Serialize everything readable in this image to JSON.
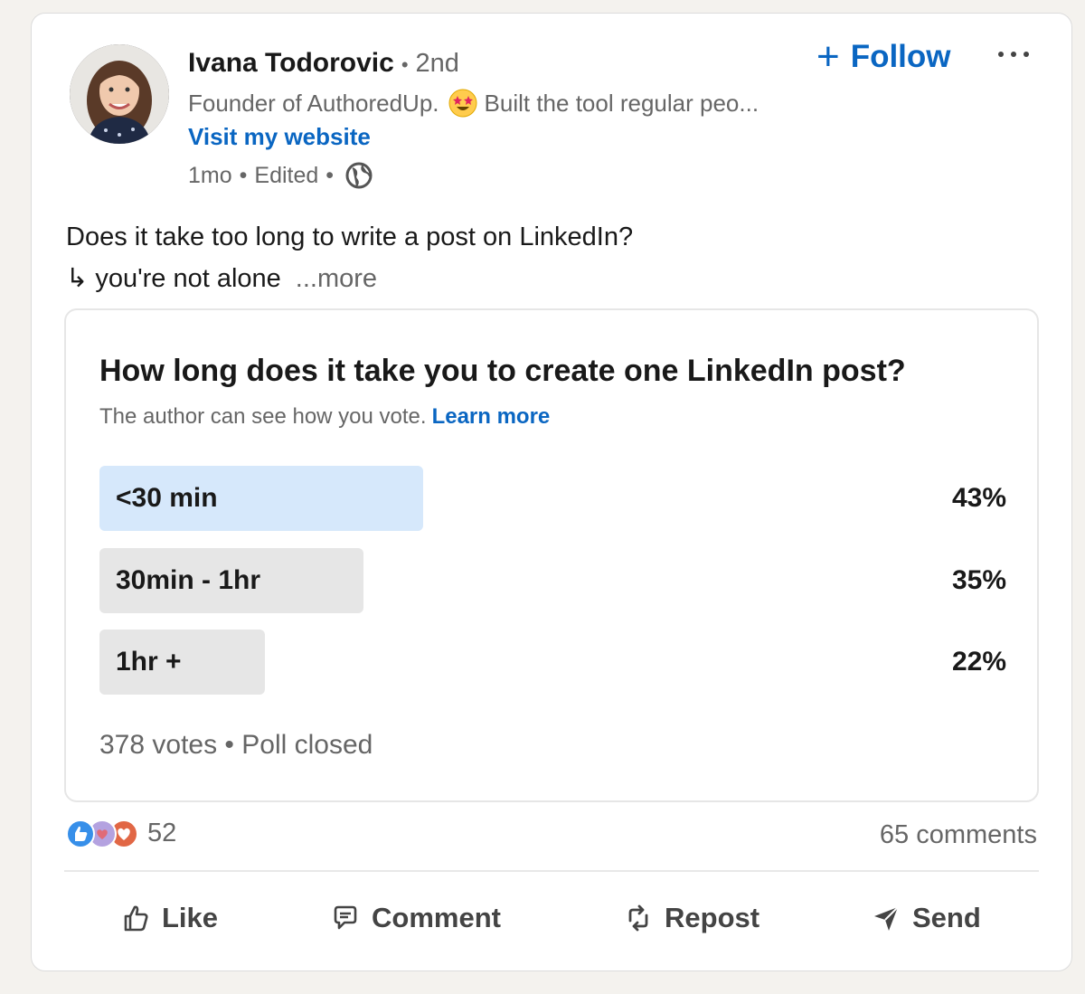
{
  "author": {
    "name": "Ivana Todorovic",
    "degree": "2nd",
    "degree_sep": "•",
    "headline_start": "Founder of AuthoredUp.",
    "headline_end": "Built the tool regular peo...",
    "website_label": "Visit my website",
    "time": "1mo",
    "edited": "Edited",
    "meta_sep": "•"
  },
  "follow_label": "Follow",
  "follow_plus": "+",
  "post": {
    "line1": "Does it take too long to write a post on LinkedIn?",
    "line2_arrow": "↳",
    "line2": "you're not alone",
    "more": "...more"
  },
  "poll": {
    "question": "How long does it take you to create one LinkedIn post?",
    "note": "The author can see how you vote.",
    "learn_more": "Learn more",
    "options": [
      {
        "label": "<30 min",
        "percent_text": "43%",
        "percent": 43,
        "selected": true
      },
      {
        "label": "30min - 1hr",
        "percent_text": "35%",
        "percent": 35,
        "selected": false
      },
      {
        "label": "1hr +",
        "percent_text": "22%",
        "percent": 22,
        "selected": false
      }
    ],
    "footer": "378 votes • Poll closed"
  },
  "social": {
    "reaction_count": "52",
    "comments": "65 comments",
    "reactions": [
      "like-icon",
      "support-icon",
      "love-icon"
    ],
    "colors": {
      "like": "#378fe9",
      "support": "#b4a2e0",
      "love": "#e16745"
    }
  },
  "actions": {
    "like": "Like",
    "comment": "Comment",
    "repost": "Repost",
    "send": "Send"
  },
  "colors": {
    "accent": "#0a66c2",
    "poll_selected": "#d6e8fb",
    "poll_bar": "#e6e6e6"
  }
}
